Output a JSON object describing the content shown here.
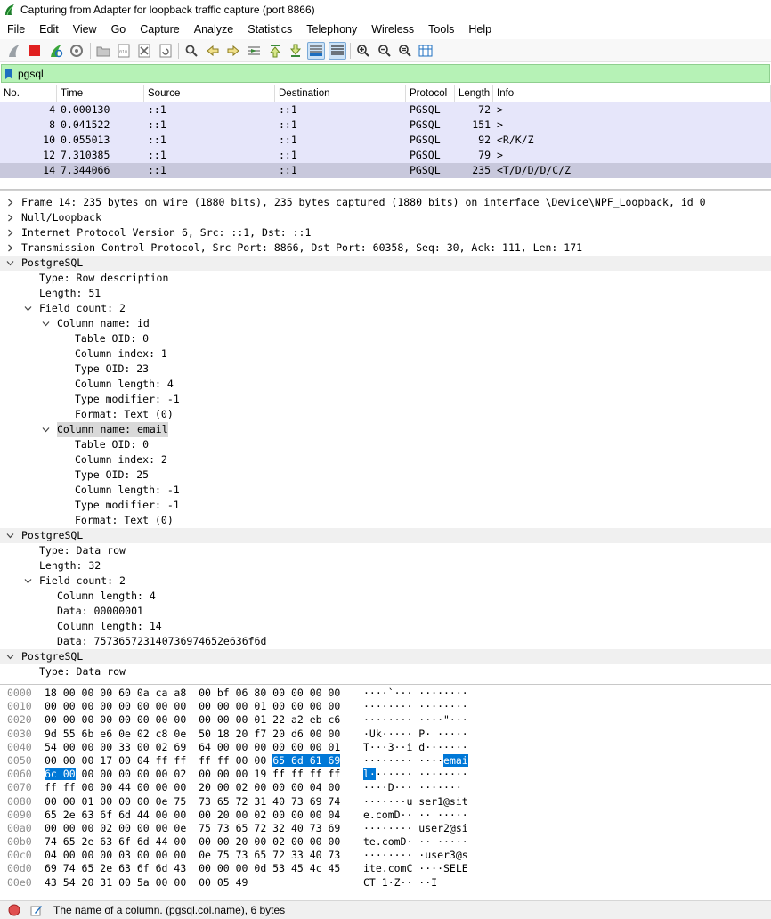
{
  "window": {
    "title": "Capturing from Adapter for loopback traffic capture (port 8866)"
  },
  "menu": [
    "File",
    "Edit",
    "View",
    "Go",
    "Capture",
    "Analyze",
    "Statistics",
    "Telephony",
    "Wireless",
    "Tools",
    "Help"
  ],
  "toolbar": {
    "buttons": [
      "shark-fin-start-icon",
      "stop-capture-icon",
      "restart-capture-icon",
      "capture-options-icon",
      "open-file-icon",
      "save-file-icon",
      "close-file-icon",
      "reload-file-icon",
      "find-packet-icon",
      "go-back-icon",
      "go-forward-icon",
      "go-to-packet-icon",
      "go-first-icon",
      "go-last-icon",
      "autoscroll-icon",
      "colorize-icon",
      "zoom-in-icon",
      "zoom-out-icon",
      "zoom-normal-icon",
      "resize-columns-icon"
    ]
  },
  "filter": {
    "value": "pgsql",
    "bg_color": "#b6f2b6"
  },
  "packet_list": {
    "columns": [
      "No.",
      "Time",
      "Source",
      "Destination",
      "Protocol",
      "Length",
      "Info"
    ],
    "rows": [
      {
        "no": "4",
        "time": "0.000130",
        "src": "::1",
        "dst": "::1",
        "proto": "PGSQL",
        "len": "72",
        "info": ">"
      },
      {
        "no": "8",
        "time": "0.041522",
        "src": "::1",
        "dst": "::1",
        "proto": "PGSQL",
        "len": "151",
        "info": ">"
      },
      {
        "no": "10",
        "time": "0.055013",
        "src": "::1",
        "dst": "::1",
        "proto": "PGSQL",
        "len": "92",
        "info": "<R/K/Z"
      },
      {
        "no": "12",
        "time": "7.310385",
        "src": "::1",
        "dst": "::1",
        "proto": "PGSQL",
        "len": "79",
        "info": ">"
      },
      {
        "no": "14",
        "time": "7.344066",
        "src": "::1",
        "dst": "::1",
        "proto": "PGSQL",
        "len": "235",
        "info": "<T/D/D/D/C/Z"
      }
    ],
    "selected_no": "14",
    "row_color": "#e6e6fa"
  },
  "details": [
    {
      "depth": 0,
      "state": "collapsed",
      "text": "Frame 14: 235 bytes on wire (1880 bits), 235 bytes captured (1880 bits) on interface \\Device\\NPF_Loopback, id 0"
    },
    {
      "depth": 0,
      "state": "collapsed",
      "text": "Null/Loopback"
    },
    {
      "depth": 0,
      "state": "collapsed",
      "text": "Internet Protocol Version 6, Src: ::1, Dst: ::1"
    },
    {
      "depth": 0,
      "state": "collapsed",
      "text": "Transmission Control Protocol, Src Port: 8866, Dst Port: 60358, Seq: 30, Ack: 111, Len: 171"
    },
    {
      "depth": 0,
      "state": "expanded",
      "text": "PostgreSQL",
      "hl": true
    },
    {
      "depth": 1,
      "state": "leaf",
      "text": "Type: Row description"
    },
    {
      "depth": 1,
      "state": "leaf",
      "text": "Length: 51"
    },
    {
      "depth": 1,
      "state": "expanded",
      "text": "Field count: 2"
    },
    {
      "depth": 2,
      "state": "expanded",
      "text": "Column name: id"
    },
    {
      "depth": 3,
      "state": "leaf",
      "text": "Table OID: 0"
    },
    {
      "depth": 3,
      "state": "leaf",
      "text": "Column index: 1"
    },
    {
      "depth": 3,
      "state": "leaf",
      "text": "Type OID: 23"
    },
    {
      "depth": 3,
      "state": "leaf",
      "text": "Column length: 4"
    },
    {
      "depth": 3,
      "state": "leaf",
      "text": "Type modifier: -1"
    },
    {
      "depth": 3,
      "state": "leaf",
      "text": "Format: Text (0)"
    },
    {
      "depth": 2,
      "state": "expanded",
      "text": "Column name: email",
      "selected": true
    },
    {
      "depth": 3,
      "state": "leaf",
      "text": "Table OID: 0"
    },
    {
      "depth": 3,
      "state": "leaf",
      "text": "Column index: 2"
    },
    {
      "depth": 3,
      "state": "leaf",
      "text": "Type OID: 25"
    },
    {
      "depth": 3,
      "state": "leaf",
      "text": "Column length: -1"
    },
    {
      "depth": 3,
      "state": "leaf",
      "text": "Type modifier: -1"
    },
    {
      "depth": 3,
      "state": "leaf",
      "text": "Format: Text (0)"
    },
    {
      "depth": 0,
      "state": "expanded",
      "text": "PostgreSQL",
      "hl": true
    },
    {
      "depth": 1,
      "state": "leaf",
      "text": "Type: Data row"
    },
    {
      "depth": 1,
      "state": "leaf",
      "text": "Length: 32"
    },
    {
      "depth": 1,
      "state": "expanded",
      "text": "Field count: 2"
    },
    {
      "depth": 2,
      "state": "leaf",
      "text": "Column length: 4"
    },
    {
      "depth": 2,
      "state": "leaf",
      "text": "Data: 00000001"
    },
    {
      "depth": 2,
      "state": "leaf",
      "text": "Column length: 14"
    },
    {
      "depth": 2,
      "state": "leaf",
      "text": "Data: 757365723140736974652e636f6d"
    },
    {
      "depth": 0,
      "state": "expanded",
      "text": "PostgreSQL",
      "hl": true
    },
    {
      "depth": 1,
      "state": "leaf",
      "text": "Type: Data row"
    }
  ],
  "bytes": [
    {
      "off": "0000",
      "hex": [
        [
          "18 00 00 00 60 0a ca a8  00 bf 06 80 00 00 00 00",
          0
        ]
      ],
      "asc": [
        [
          "····`··· ········",
          0
        ]
      ]
    },
    {
      "off": "0010",
      "hex": [
        [
          "00 00 00 00 00 00 00 00  00 00 00 01 00 00 00 00",
          0
        ]
      ],
      "asc": [
        [
          "········ ········",
          0
        ]
      ]
    },
    {
      "off": "0020",
      "hex": [
        [
          "00 00 00 00 00 00 00 00  00 00 00 01 22 a2 eb c6",
          0
        ]
      ],
      "asc": [
        [
          "········ ····\"···",
          0
        ]
      ]
    },
    {
      "off": "0030",
      "hex": [
        [
          "9d 55 6b e6 0e 02 c8 0e  50 18 20 f7 20 d6 00 00",
          0
        ]
      ],
      "asc": [
        [
          "·Uk····· P· ·····",
          0
        ]
      ]
    },
    {
      "off": "0040",
      "hex": [
        [
          "54 00 00 00 33 00 02 69  64 00 00 00 00 00 00 01",
          0
        ]
      ],
      "asc": [
        [
          "T···3··i d·······",
          0
        ]
      ]
    },
    {
      "off": "0050",
      "hex": [
        [
          "00 00 00 17 00 04 ff ff  ff ff 00 00 ",
          0
        ],
        [
          "65 6d 61 69",
          1
        ]
      ],
      "asc": [
        [
          "········ ····",
          0
        ],
        [
          "emai",
          1
        ]
      ]
    },
    {
      "off": "0060",
      "hex": [
        [
          "6c 00",
          1
        ],
        [
          " 00 00 00 00 00 02  00 00 00 19 ff ff ff ff",
          0
        ]
      ],
      "asc": [
        [
          "l·",
          1
        ],
        [
          "······ ········",
          0
        ]
      ]
    },
    {
      "off": "0070",
      "hex": [
        [
          "ff ff 00 00 44 00 00 00  20 00 02 00 00 00 04 00",
          0
        ]
      ],
      "asc": [
        [
          "····D··· ·······",
          0
        ]
      ]
    },
    {
      "off": "0080",
      "hex": [
        [
          "00 00 01 00 00 00 0e 75  73 65 72 31 40 73 69 74",
          0
        ]
      ],
      "asc": [
        [
          "·······u ser1@sit",
          0
        ]
      ]
    },
    {
      "off": "0090",
      "hex": [
        [
          "65 2e 63 6f 6d 44 00 00  00 20 00 02 00 00 00 04",
          0
        ]
      ],
      "asc": [
        [
          "e.comD·· ·· ·····",
          0
        ]
      ]
    },
    {
      "off": "00a0",
      "hex": [
        [
          "00 00 00 02 00 00 00 0e  75 73 65 72 32 40 73 69",
          0
        ]
      ],
      "asc": [
        [
          "········ user2@si",
          0
        ]
      ]
    },
    {
      "off": "00b0",
      "hex": [
        [
          "74 65 2e 63 6f 6d 44 00  00 00 20 00 02 00 00 00",
          0
        ]
      ],
      "asc": [
        [
          "te.comD· ·· ·····",
          0
        ]
      ]
    },
    {
      "off": "00c0",
      "hex": [
        [
          "04 00 00 00 03 00 00 00  0e 75 73 65 72 33 40 73",
          0
        ]
      ],
      "asc": [
        [
          "········ ·user3@s",
          0
        ]
      ]
    },
    {
      "off": "00d0",
      "hex": [
        [
          "69 74 65 2e 63 6f 6d 43  00 00 00 0d 53 45 4c 45",
          0
        ]
      ],
      "asc": [
        [
          "ite.comC ····SELE",
          0
        ]
      ]
    },
    {
      "off": "00e0",
      "hex": [
        [
          "43 54 20 31 00 5a 00 00  00 05 49",
          0
        ]
      ],
      "asc": [
        [
          "CT 1·Z·· ··I",
          0
        ]
      ]
    }
  ],
  "status": {
    "text": "The name of a column. (pgsql.col.name), 6 bytes"
  }
}
